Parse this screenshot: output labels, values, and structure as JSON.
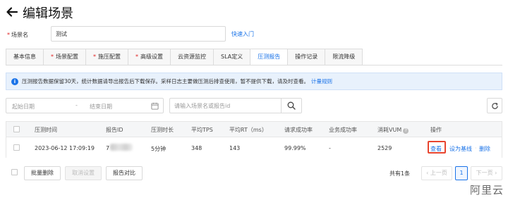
{
  "header": {
    "title": "编辑场景"
  },
  "scene": {
    "required_mark": "*",
    "label": "场景名",
    "value": "测试",
    "quick_link": "快速入门"
  },
  "tabs": [
    {
      "label": "基本信息",
      "required": false
    },
    {
      "label": "场景配置",
      "required": true
    },
    {
      "label": "施压配置",
      "required": true
    },
    {
      "label": "高级设置",
      "required": true
    },
    {
      "label": "云资源监控",
      "required": false
    },
    {
      "label": "SLA定义",
      "required": false
    },
    {
      "label": "压测报告",
      "required": false,
      "active": true
    },
    {
      "label": "操作记录",
      "required": false
    },
    {
      "label": "限流降级",
      "required": false
    }
  ],
  "notice": {
    "text": "压测报告数据保留30天，统计数据请导出报告后下载保存。采样日志主要做压测后排查使用，暂不提供下载，请及时查看。",
    "link": "计量规则"
  },
  "filter": {
    "start_placeholder": "起始日期",
    "separator": "-",
    "end_placeholder": "结束日期",
    "search_placeholder": "请输入场景名或报告id"
  },
  "table": {
    "columns": [
      "压测时间",
      "报告ID",
      "压测时长",
      "平均TPS",
      "平均RT（ms）",
      "请求成功率",
      "业务成功率",
      "消耗VUM",
      "操作"
    ],
    "rows": [
      {
        "time": "2023-06-12 17:09:19",
        "report_id_prefix": "7",
        "duration": "5分钟",
        "avg_tps": "348",
        "avg_rt": "143",
        "req_success": "99.99%",
        "biz_success": "-",
        "vum": "2529",
        "actions": {
          "view": "查看",
          "baseline": "设为基线",
          "delete": "删除"
        }
      }
    ]
  },
  "bottom": {
    "batch_delete": "批量删除",
    "cancel_selection": "取消设置",
    "compare": "报告对比",
    "total": "共有1条",
    "prev": "上一页",
    "page": "1",
    "next": "下一页"
  },
  "watermark": "阿里云",
  "colors": {
    "primary": "#1a73e8",
    "highlight_box": "#e8452f",
    "required": "#e02020"
  }
}
